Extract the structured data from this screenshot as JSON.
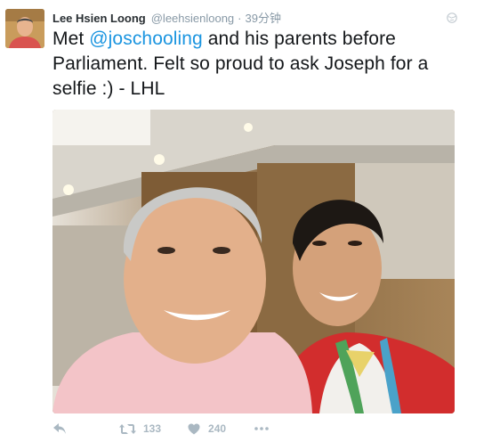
{
  "tweet": {
    "author_name": "Lee Hsien Loong",
    "handle": "@leehsienloong",
    "separator": "·",
    "time": "39分钟",
    "text_before": "Met ",
    "mention": "@joschooling",
    "text_after": " and his parents before Parliament. Felt so proud to ask Joseph for a selfie :) - LHL"
  },
  "actions": {
    "retweet_count": "133",
    "like_count": "240"
  },
  "colors": {
    "link": "#1b95e0",
    "meta": "#8899a6",
    "action_icon": "#aab8c2"
  },
  "icons": [
    "globe-icon",
    "reply-icon",
    "retweet-icon",
    "heart-icon",
    "more-icon"
  ]
}
